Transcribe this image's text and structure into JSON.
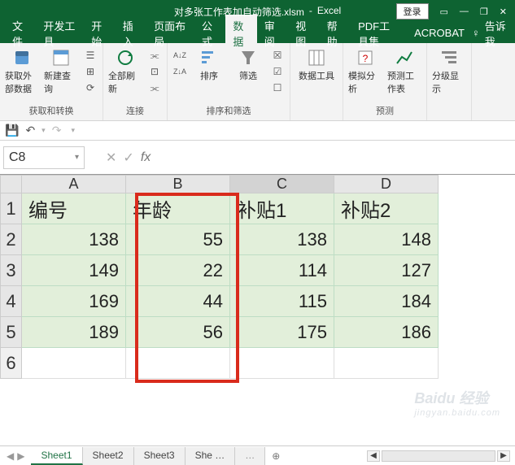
{
  "title": {
    "filename": "对多张工作表加自动筛选.xlsm",
    "app": "Excel",
    "login": "登录"
  },
  "win": {
    "restore": "❐",
    "min": "—",
    "close": "✕",
    "ribbon_opts": "▭"
  },
  "menu": {
    "tabs": [
      "文件",
      "开发工具",
      "开始",
      "插入",
      "页面布局",
      "公式",
      "数据",
      "审阅",
      "视图",
      "帮助",
      "PDF工具集",
      "ACROBAT"
    ],
    "active_index": 6,
    "bulb": "♀",
    "tell": "告诉我"
  },
  "ribbon": {
    "groups": [
      {
        "label": "获取和转换",
        "items": [
          {
            "t": "获取外部数据",
            "sub": "▾"
          },
          {
            "t": "新建查询",
            "sub": "▾"
          }
        ],
        "minis": [
          "☰",
          "⊞",
          "⟳"
        ]
      },
      {
        "label": "连接",
        "items": [
          {
            "t": "全部刷新",
            "sub": "▾"
          }
        ],
        "minis": [
          "⫘",
          "⊡",
          "⫘"
        ]
      },
      {
        "label": "排序和筛选",
        "items": [
          {
            "t": "排序"
          },
          {
            "t": "筛选"
          }
        ],
        "pre": [
          "A↓Z",
          "Z↓A"
        ],
        "minis": [
          "☒",
          "☑",
          "☐"
        ]
      },
      {
        "label": "",
        "items": [
          {
            "t": "数据工具"
          }
        ],
        "minis": [
          "▭",
          "⊟",
          "⊡",
          "▦",
          "☲",
          "⊞"
        ]
      },
      {
        "label": "预测",
        "items": [
          {
            "t": "模拟分析",
            "sub": "▾"
          },
          {
            "t": "预测工作表"
          }
        ]
      },
      {
        "label": "",
        "items": [
          {
            "t": "分级显示",
            "sub": "▾"
          }
        ]
      }
    ]
  },
  "qat": {
    "save": "💾",
    "undo": "↶",
    "redo": "↷",
    "dd": "▾"
  },
  "fx": {
    "cellref": "C8",
    "cancel": "✕",
    "accept": "✓",
    "fx": "fx",
    "value": ""
  },
  "grid": {
    "cols": [
      "A",
      "B",
      "C",
      "D"
    ],
    "rowhdrs": [
      "1",
      "2",
      "3",
      "4",
      "5",
      "6"
    ],
    "headers": [
      "编号",
      "年龄",
      "补贴1",
      "补贴2"
    ],
    "rows": [
      [
        "138",
        "55",
        "138",
        "148"
      ],
      [
        "149",
        "22",
        "114",
        "127"
      ],
      [
        "169",
        "44",
        "115",
        "184"
      ],
      [
        "189",
        "56",
        "175",
        "186"
      ]
    ]
  },
  "sheets": {
    "nav_l": "◀",
    "nav_r": "▶",
    "tabs": [
      "Sheet1",
      "Sheet2",
      "Sheet3",
      "She …"
    ],
    "more": "…",
    "add": "⊕",
    "active": 0,
    "scroll_l": "◀",
    "scroll_r": "▶"
  },
  "watermark": {
    "brand": "Baidu 经验",
    "url": "jingyan.baidu.com"
  }
}
